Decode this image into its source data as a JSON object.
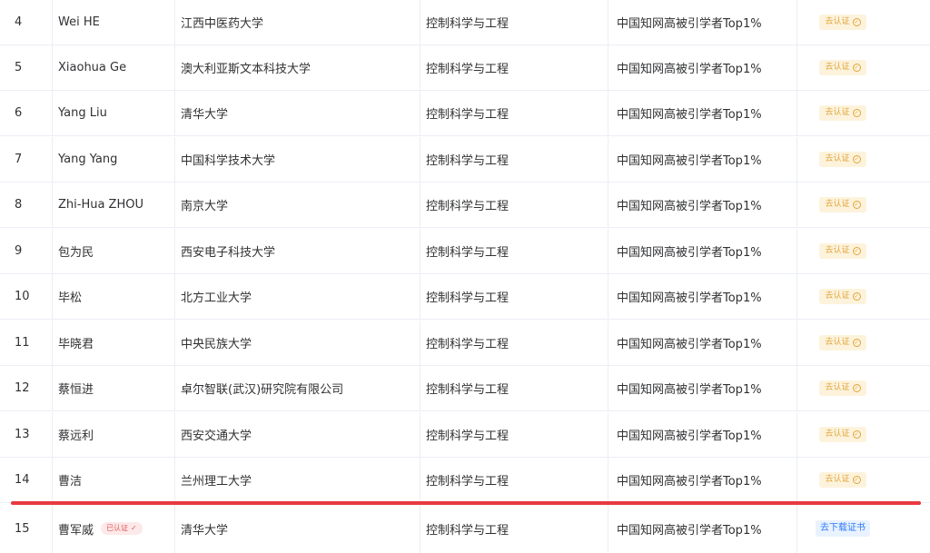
{
  "rows": [
    {
      "index": "4",
      "name": "Wei HE",
      "org": "江西中医药大学",
      "field": "控制科学与工程",
      "title": "中国知网高被引学者Top1%",
      "action": "去认证"
    },
    {
      "index": "5",
      "name": "Xiaohua Ge",
      "org": "澳大利亚斯文本科技大学",
      "field": "控制科学与工程",
      "title": "中国知网高被引学者Top1%",
      "action": "去认证"
    },
    {
      "index": "6",
      "name": "Yang Liu",
      "org": "清华大学",
      "field": "控制科学与工程",
      "title": "中国知网高被引学者Top1%",
      "action": "去认证"
    },
    {
      "index": "7",
      "name": "Yang Yang",
      "org": "中国科学技术大学",
      "field": "控制科学与工程",
      "title": "中国知网高被引学者Top1%",
      "action": "去认证"
    },
    {
      "index": "8",
      "name": "Zhi-Hua ZHOU",
      "org": "南京大学",
      "field": "控制科学与工程",
      "title": "中国知网高被引学者Top1%",
      "action": "去认证"
    },
    {
      "index": "9",
      "name": "包为民",
      "org": "西安电子科技大学",
      "field": "控制科学与工程",
      "title": "中国知网高被引学者Top1%",
      "action": "去认证"
    },
    {
      "index": "10",
      "name": "毕松",
      "org": "北方工业大学",
      "field": "控制科学与工程",
      "title": "中国知网高被引学者Top1%",
      "action": "去认证"
    },
    {
      "index": "11",
      "name": "毕晓君",
      "org": "中央民族大学",
      "field": "控制科学与工程",
      "title": "中国知网高被引学者Top1%",
      "action": "去认证"
    },
    {
      "index": "12",
      "name": "蔡恒进",
      "org": "卓尔智联(武汉)研究院有限公司",
      "field": "控制科学与工程",
      "title": "中国知网高被引学者Top1%",
      "action": "去认证"
    },
    {
      "index": "13",
      "name": "蔡远利",
      "org": "西安交通大学",
      "field": "控制科学与工程",
      "title": "中国知网高被引学者Top1%",
      "action": "去认证"
    },
    {
      "index": "14",
      "name": "曹洁",
      "org": "兰州理工大学",
      "field": "控制科学与工程",
      "title": "中国知网高被引学者Top1%",
      "action": "去认证"
    }
  ],
  "last_row": {
    "index": "15",
    "name": "曹军威",
    "verified_tag": "已认证",
    "org": "清华大学",
    "field": "控制科学与工程",
    "title": "中国知网高被引学者Top1%",
    "action": "去下载证书"
  },
  "colors": {
    "divider": "#e8393f",
    "badge": "#e0a53b",
    "link": "#2f7bf5"
  }
}
